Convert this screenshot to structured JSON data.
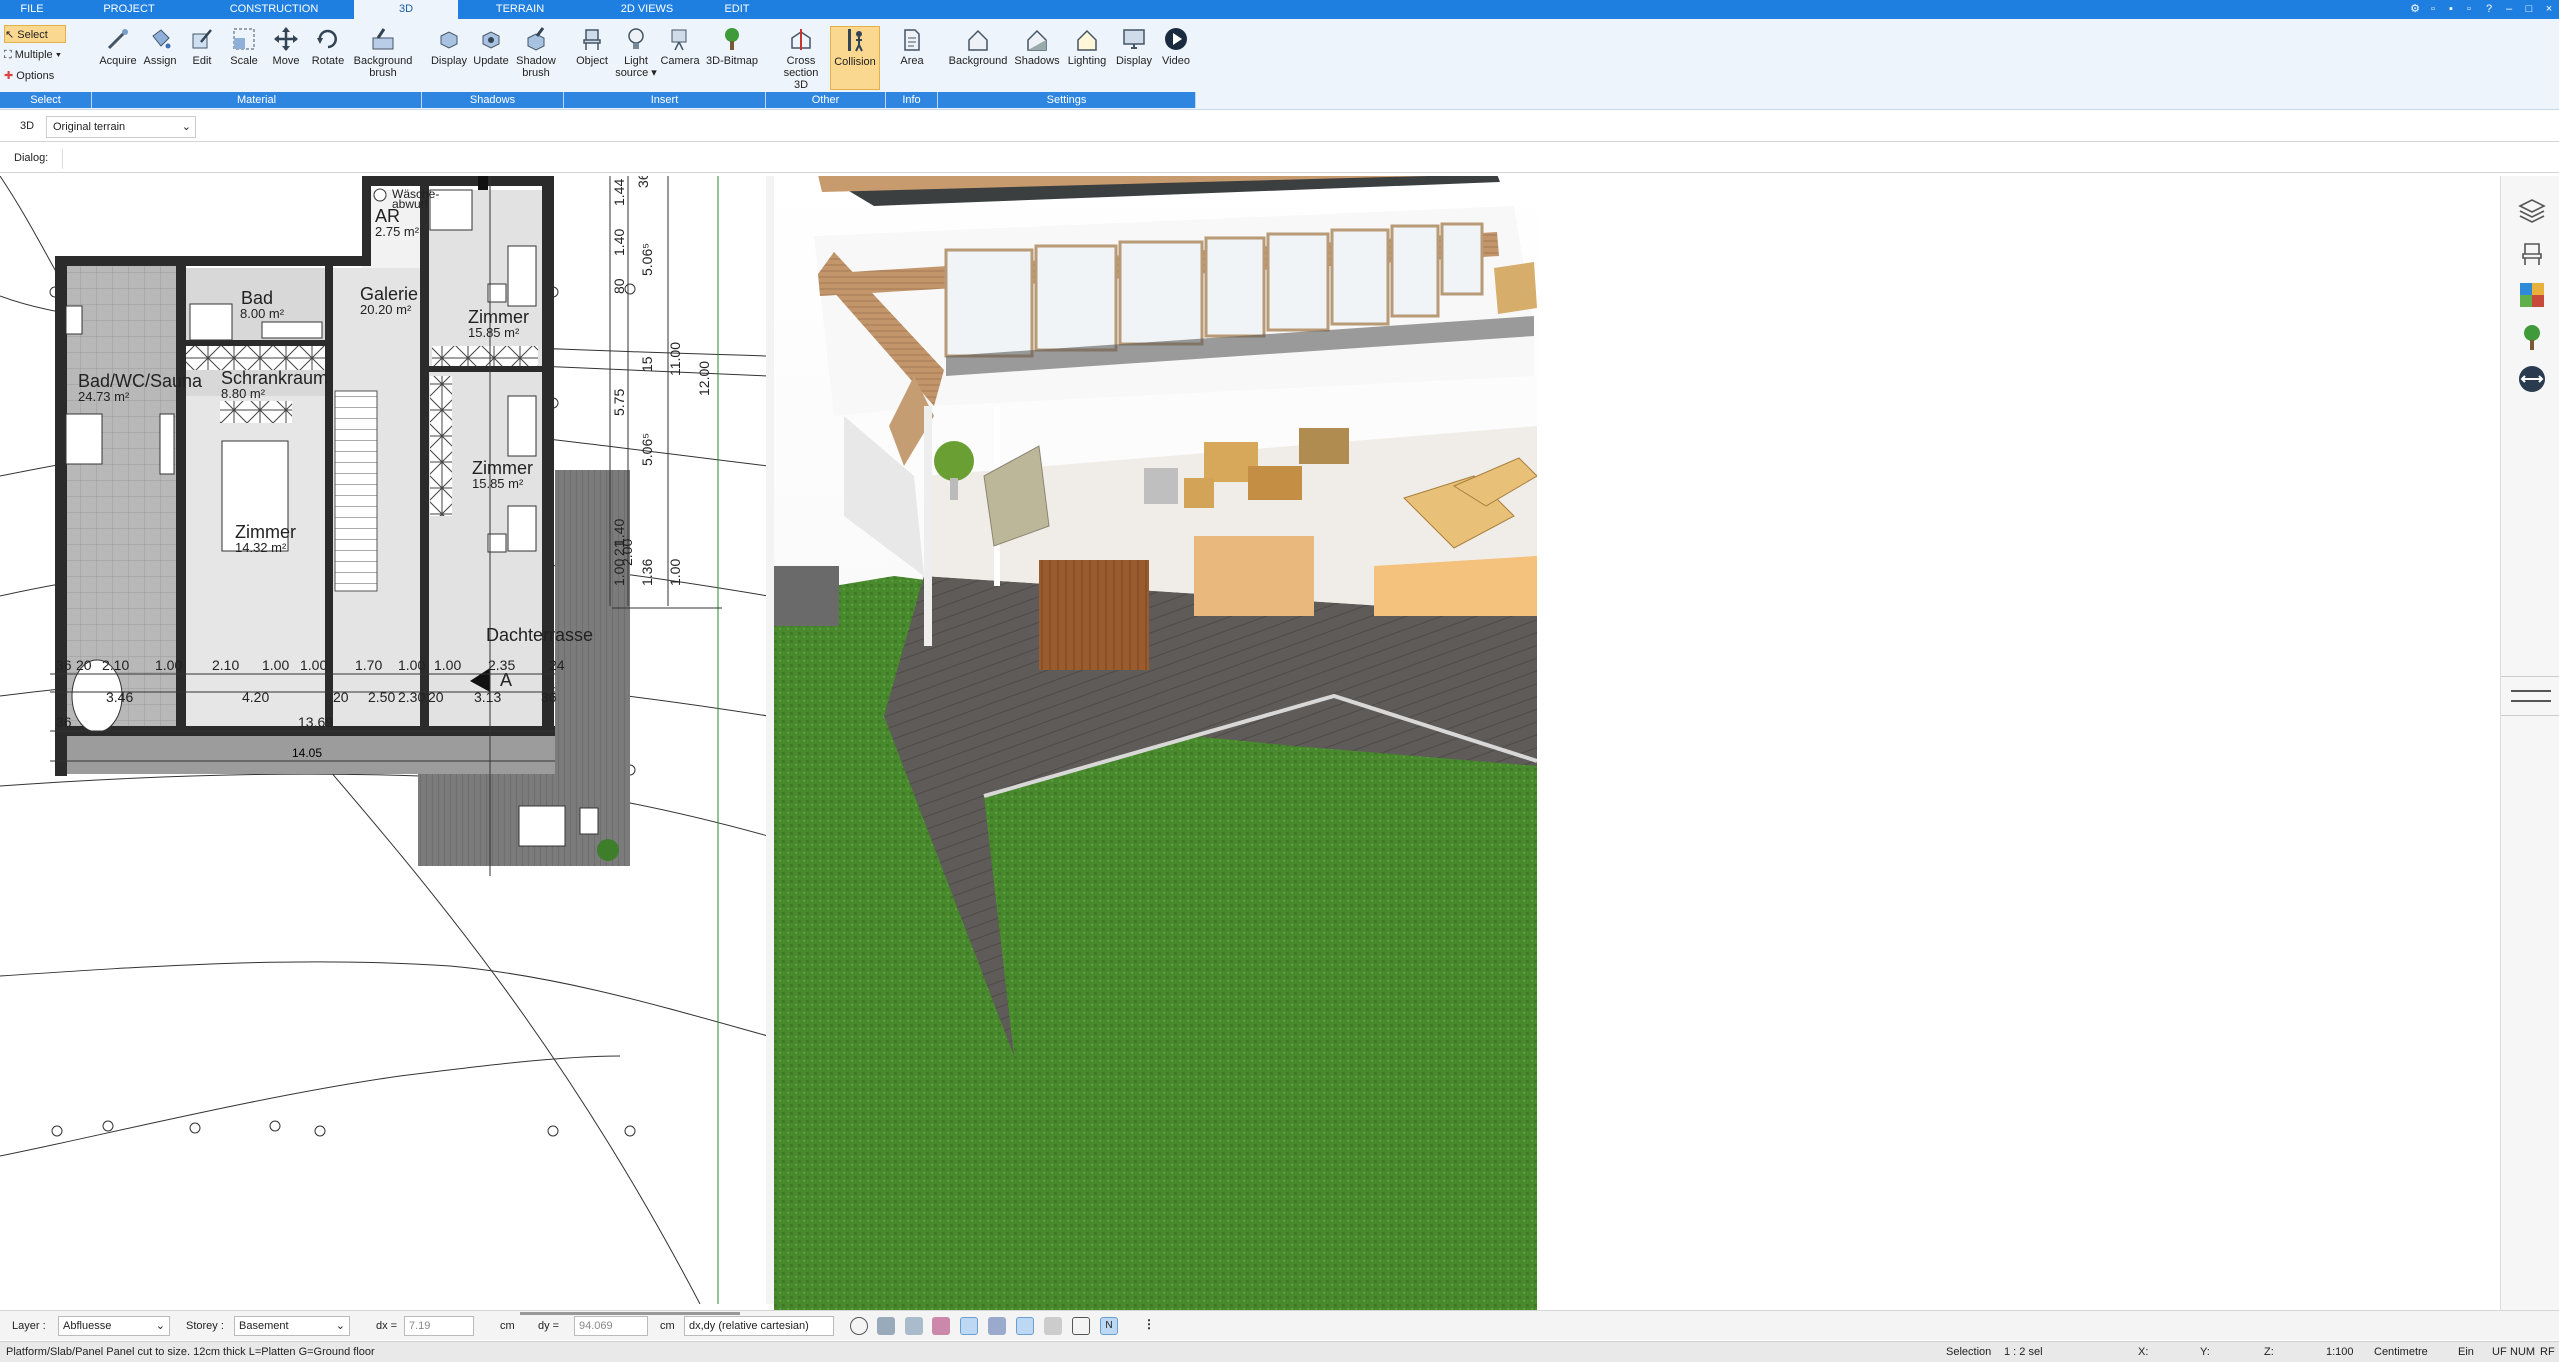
{
  "menu": {
    "tabs": [
      {
        "label": "FILE"
      },
      {
        "label": "PROJECT"
      },
      {
        "label": "CONSTRUCTION"
      },
      {
        "label": "3D",
        "active": true
      },
      {
        "label": "TERRAIN"
      },
      {
        "label": "2D VIEWS"
      },
      {
        "label": "EDIT"
      }
    ]
  },
  "ribbon": {
    "select": {
      "select": "Select",
      "multiple": "Multiple",
      "options": "Options"
    },
    "material": {
      "acquire": "Acquire",
      "assign": "Assign",
      "edit": "Edit",
      "scale": "Scale",
      "move": "Move",
      "rotate": "Rotate",
      "bg_brush_1": "Background",
      "bg_brush_2": "brush"
    },
    "shadows": {
      "display": "Display",
      "update": "Update",
      "shadow_brush_1": "Shadow",
      "shadow_brush_2": "brush"
    },
    "insert": {
      "object": "Object",
      "light_1": "Light",
      "light_2": "source",
      "camera": "Camera",
      "bitmap": "3D-Bitmap"
    },
    "other": {
      "cross_1": "Cross",
      "cross_2": "section 3D",
      "collision": "Collision"
    },
    "info": {
      "area": "Area"
    },
    "settings": {
      "background": "Background",
      "shadows": "Shadows",
      "lighting": "Lighting",
      "display": "Display",
      "video": "Video"
    },
    "groups": {
      "select": "Select",
      "material": "Material",
      "shadows": "Shadows",
      "insert": "Insert",
      "other": "Other",
      "info": "Info",
      "settings": "Settings"
    }
  },
  "viewbar": {
    "mode": "3D",
    "terrain": "Original terrain"
  },
  "dialog": {
    "label": "Dialog:"
  },
  "plan": {
    "rooms": [
      {
        "name": "AR",
        "area": "2.75 m²"
      },
      {
        "name": "Bad",
        "area": "8.00 m²"
      },
      {
        "name": "Galerie",
        "area": "20.20 m²"
      },
      {
        "name": "Zimmer",
        "area": "15.85 m²"
      },
      {
        "name": "Bad/WC/Sauna",
        "area": "24.73 m²"
      },
      {
        "name": "Schrankraum",
        "area": "8.80 m²"
      },
      {
        "name": "Zimmer",
        "area": "15.85 m²"
      },
      {
        "name": "Zimmer",
        "area": "14.32 m²"
      },
      {
        "name": "Dachterrasse",
        "area": ""
      }
    ],
    "laundry_1": "Wäsche-",
    "laundry_2": "abwurf",
    "section_mark": "A",
    "top_dims": [
      "80",
      "80"
    ],
    "dims_row1": [
      "36",
      "20",
      "2.10",
      "1.00",
      "2.10",
      "1.00",
      "1.00",
      "1.70",
      "1.00",
      "1.00",
      "2.35",
      "24"
    ],
    "dims_row2": [
      "3.46",
      "4.20",
      "20",
      "2.50",
      "2.30",
      "20",
      "3.13",
      "36"
    ],
    "dims_row3": [
      "36",
      "13.69"
    ],
    "dims_row4": [
      "14.05"
    ],
    "right_dims": [
      "36",
      "1.44",
      "1.40",
      "80",
      "15",
      "5.75",
      "5.06⁵",
      "11.00",
      "12.00",
      "1.40",
      "5.06⁵",
      "21",
      "2.00",
      "1.00",
      "1.36",
      "1.00"
    ]
  },
  "options": {
    "layer_label": "Layer :",
    "layer_value": "Abfluesse",
    "storey_label": "Storey :",
    "storey_value": "Basement",
    "dx_label": "dx =",
    "dx_value": "7.19",
    "dy_label": "dy =",
    "dy_value": "94.069",
    "unit": "cm",
    "coord_mode": "dx,dy (relative cartesian)"
  },
  "status": {
    "message": "Platform/Slab/Panel Panel cut to size. 12cm thick L=Platten G=Ground floor",
    "selection_label": "Selection",
    "selection_value": "1 : 2 sel",
    "x": "X:",
    "y": "Y:",
    "z": "Z:",
    "scale": "1:100",
    "unit": "Centimetre",
    "ein": "Ein",
    "uf": "UF",
    "num": "NUM",
    "rf": "RF"
  },
  "colors": {
    "accent": "#1f7fe0",
    "ribbon_bg": "#eef4fb",
    "grass": "#4a8a2e",
    "deck": "#5e5b58"
  }
}
